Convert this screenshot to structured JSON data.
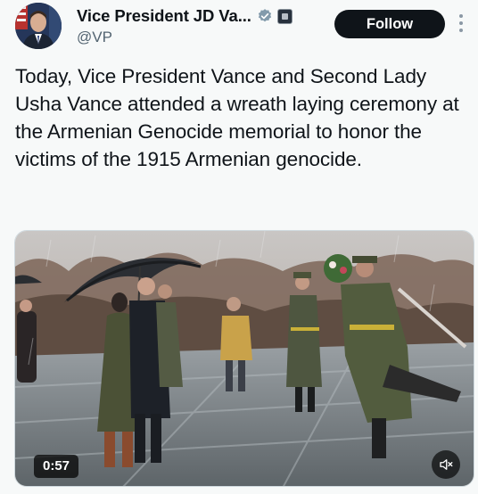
{
  "author": {
    "display_name": "Vice President JD Va...",
    "handle": "@VP",
    "avatar_icon": "portrait-avatar",
    "verified_icon": "verified-badge-icon",
    "affiliation_icon": "government-affiliation-icon"
  },
  "actions": {
    "follow_label": "Follow",
    "more_icon": "more-vertical-icon"
  },
  "tweet": {
    "text": "Today, Vice President Vance and Second Lady Usha Vance attended a wreath laying ceremony at the Armenian Genocide memorial to honor the victims of the 1915 Armenian genocide."
  },
  "video": {
    "duration": "0:57",
    "mute_icon": "speaker-muted-icon"
  },
  "colors": {
    "follow_bg": "#0f1419",
    "text": "#0f1419",
    "secondary_text": "#536471",
    "verified": "#829aab",
    "background": "#f7f9f9"
  }
}
